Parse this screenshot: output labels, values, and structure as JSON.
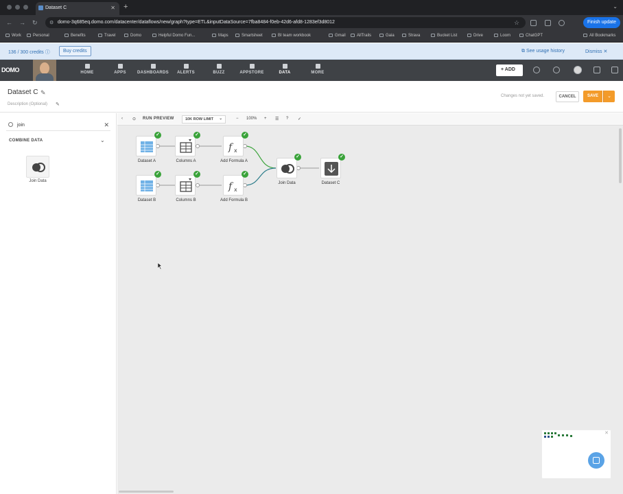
{
  "browser": {
    "tab_title": "Dataset C",
    "url": "domo-3q685eq.domo.com/datacenter/dataflows/new/graph?type=ETL&inputDataSource=7fba8484-f0eb-42d6-afd8-1283ef3d8012",
    "finish_update": "Finish update",
    "bookmarks": [
      "Work",
      "Personal",
      "Benefits",
      "Travel",
      "Domo",
      "Helpful Domo Fun...",
      "Maps",
      "Smartsheet",
      "BI team workbook",
      "Gmail",
      "AllTrails",
      "Gaia",
      "Strava",
      "Bucket List",
      "Drive",
      "Loom",
      "ChatGPT"
    ],
    "all_bookmarks": "All Bookmarks"
  },
  "credits": {
    "count": "136 / 300 credits",
    "buy": "Buy credits",
    "usage": "See usage history",
    "dismiss": "Dismiss"
  },
  "nav": {
    "logo": "DOMO",
    "items": [
      {
        "label": "HOME",
        "icon": "home-icon"
      },
      {
        "label": "APPS",
        "icon": "apps-icon"
      },
      {
        "label": "DASHBOARDS",
        "icon": "dashboards-icon"
      },
      {
        "label": "ALERTS",
        "icon": "alerts-icon"
      },
      {
        "label": "BUZZ",
        "icon": "buzz-icon"
      },
      {
        "label": "APPSTORE",
        "icon": "appstore-icon"
      },
      {
        "label": "DATA",
        "icon": "data-icon"
      },
      {
        "label": "MORE",
        "icon": "more-icon"
      }
    ],
    "active": "DATA",
    "add": "+ ADD"
  },
  "header": {
    "title": "Dataset C",
    "description": "Description (Optional)",
    "unsaved": "Changes not yet saved.",
    "cancel": "CANCEL",
    "save": "SAVE"
  },
  "sidebar": {
    "search_value": "join",
    "section": "COMBINE DATA",
    "tiles": [
      {
        "label": "Join Data",
        "icon": "join-icon"
      }
    ]
  },
  "toolbar": {
    "run_preview": "RUN PREVIEW",
    "row_limit": "10K ROW LIMIT",
    "zoom": "100%"
  },
  "nodes": [
    {
      "label": "Dataset A",
      "icon": "table-icon"
    },
    {
      "label": "Columns A",
      "icon": "columns-icon"
    },
    {
      "label": "Add Formula A",
      "icon": "formula-icon"
    },
    {
      "label": "Dataset B",
      "icon": "table-icon"
    },
    {
      "label": "Columns B",
      "icon": "columns-icon"
    },
    {
      "label": "Add Formula B",
      "icon": "formula-icon"
    },
    {
      "label": "Join Data",
      "icon": "join-icon"
    },
    {
      "label": "Dataset C",
      "icon": "output-icon"
    }
  ],
  "colors": {
    "accent": "#f39b2a",
    "success": "#3aa33a",
    "link": "#2f6fb3"
  }
}
